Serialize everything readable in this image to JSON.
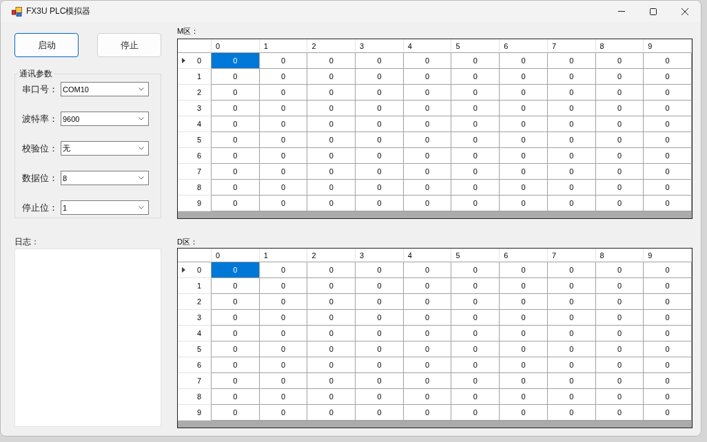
{
  "window": {
    "title": "FX3U PLC模拟器"
  },
  "buttons": [
    {
      "label": "启动",
      "focused": true
    },
    {
      "label": "停止",
      "focused": false
    }
  ],
  "comm_settings": {
    "title": "通讯参数",
    "fields": [
      {
        "label": "串口号：",
        "value": "COM10"
      },
      {
        "label": "波特率：",
        "value": "9600"
      },
      {
        "label": "校验位：",
        "value": "无"
      },
      {
        "label": "数据位：",
        "value": "8"
      },
      {
        "label": "停止位：",
        "value": "1"
      }
    ]
  },
  "log": {
    "label": "日志："
  },
  "grids": [
    {
      "label": "M区：",
      "columns": [
        "0",
        "1",
        "2",
        "3",
        "4",
        "5",
        "6",
        "7",
        "8",
        "9"
      ],
      "rows": [
        {
          "header": "0",
          "current": true,
          "cells": [
            {
              "value": "0",
              "selected": true
            },
            {
              "value": "0",
              "selected": false
            },
            {
              "value": "0",
              "selected": false
            },
            {
              "value": "0",
              "selected": false
            },
            {
              "value": "0",
              "selected": false
            },
            {
              "value": "0",
              "selected": false
            },
            {
              "value": "0",
              "selected": false
            },
            {
              "value": "0",
              "selected": false
            },
            {
              "value": "0",
              "selected": false
            },
            {
              "value": "0",
              "selected": false
            }
          ]
        },
        {
          "header": "1",
          "current": false,
          "cells": [
            {
              "value": "0",
              "selected": false
            },
            {
              "value": "0",
              "selected": false
            },
            {
              "value": "0",
              "selected": false
            },
            {
              "value": "0",
              "selected": false
            },
            {
              "value": "0",
              "selected": false
            },
            {
              "value": "0",
              "selected": false
            },
            {
              "value": "0",
              "selected": false
            },
            {
              "value": "0",
              "selected": false
            },
            {
              "value": "0",
              "selected": false
            },
            {
              "value": "0",
              "selected": false
            }
          ]
        },
        {
          "header": "2",
          "current": false,
          "cells": [
            {
              "value": "0",
              "selected": false
            },
            {
              "value": "0",
              "selected": false
            },
            {
              "value": "0",
              "selected": false
            },
            {
              "value": "0",
              "selected": false
            },
            {
              "value": "0",
              "selected": false
            },
            {
              "value": "0",
              "selected": false
            },
            {
              "value": "0",
              "selected": false
            },
            {
              "value": "0",
              "selected": false
            },
            {
              "value": "0",
              "selected": false
            },
            {
              "value": "0",
              "selected": false
            }
          ]
        },
        {
          "header": "3",
          "current": false,
          "cells": [
            {
              "value": "0",
              "selected": false
            },
            {
              "value": "0",
              "selected": false
            },
            {
              "value": "0",
              "selected": false
            },
            {
              "value": "0",
              "selected": false
            },
            {
              "value": "0",
              "selected": false
            },
            {
              "value": "0",
              "selected": false
            },
            {
              "value": "0",
              "selected": false
            },
            {
              "value": "0",
              "selected": false
            },
            {
              "value": "0",
              "selected": false
            },
            {
              "value": "0",
              "selected": false
            }
          ]
        },
        {
          "header": "4",
          "current": false,
          "cells": [
            {
              "value": "0",
              "selected": false
            },
            {
              "value": "0",
              "selected": false
            },
            {
              "value": "0",
              "selected": false
            },
            {
              "value": "0",
              "selected": false
            },
            {
              "value": "0",
              "selected": false
            },
            {
              "value": "0",
              "selected": false
            },
            {
              "value": "0",
              "selected": false
            },
            {
              "value": "0",
              "selected": false
            },
            {
              "value": "0",
              "selected": false
            },
            {
              "value": "0",
              "selected": false
            }
          ]
        },
        {
          "header": "5",
          "current": false,
          "cells": [
            {
              "value": "0",
              "selected": false
            },
            {
              "value": "0",
              "selected": false
            },
            {
              "value": "0",
              "selected": false
            },
            {
              "value": "0",
              "selected": false
            },
            {
              "value": "0",
              "selected": false
            },
            {
              "value": "0",
              "selected": false
            },
            {
              "value": "0",
              "selected": false
            },
            {
              "value": "0",
              "selected": false
            },
            {
              "value": "0",
              "selected": false
            },
            {
              "value": "0",
              "selected": false
            }
          ]
        },
        {
          "header": "6",
          "current": false,
          "cells": [
            {
              "value": "0",
              "selected": false
            },
            {
              "value": "0",
              "selected": false
            },
            {
              "value": "0",
              "selected": false
            },
            {
              "value": "0",
              "selected": false
            },
            {
              "value": "0",
              "selected": false
            },
            {
              "value": "0",
              "selected": false
            },
            {
              "value": "0",
              "selected": false
            },
            {
              "value": "0",
              "selected": false
            },
            {
              "value": "0",
              "selected": false
            },
            {
              "value": "0",
              "selected": false
            }
          ]
        },
        {
          "header": "7",
          "current": false,
          "cells": [
            {
              "value": "0",
              "selected": false
            },
            {
              "value": "0",
              "selected": false
            },
            {
              "value": "0",
              "selected": false
            },
            {
              "value": "0",
              "selected": false
            },
            {
              "value": "0",
              "selected": false
            },
            {
              "value": "0",
              "selected": false
            },
            {
              "value": "0",
              "selected": false
            },
            {
              "value": "0",
              "selected": false
            },
            {
              "value": "0",
              "selected": false
            },
            {
              "value": "0",
              "selected": false
            }
          ]
        },
        {
          "header": "8",
          "current": false,
          "cells": [
            {
              "value": "0",
              "selected": false
            },
            {
              "value": "0",
              "selected": false
            },
            {
              "value": "0",
              "selected": false
            },
            {
              "value": "0",
              "selected": false
            },
            {
              "value": "0",
              "selected": false
            },
            {
              "value": "0",
              "selected": false
            },
            {
              "value": "0",
              "selected": false
            },
            {
              "value": "0",
              "selected": false
            },
            {
              "value": "0",
              "selected": false
            },
            {
              "value": "0",
              "selected": false
            }
          ]
        },
        {
          "header": "9",
          "current": false,
          "cells": [
            {
              "value": "0",
              "selected": false
            },
            {
              "value": "0",
              "selected": false
            },
            {
              "value": "0",
              "selected": false
            },
            {
              "value": "0",
              "selected": false
            },
            {
              "value": "0",
              "selected": false
            },
            {
              "value": "0",
              "selected": false
            },
            {
              "value": "0",
              "selected": false
            },
            {
              "value": "0",
              "selected": false
            },
            {
              "value": "0",
              "selected": false
            },
            {
              "value": "0",
              "selected": false
            }
          ]
        }
      ]
    },
    {
      "label": "D区：",
      "columns": [
        "0",
        "1",
        "2",
        "3",
        "4",
        "5",
        "6",
        "7",
        "8",
        "9"
      ],
      "rows": [
        {
          "header": "0",
          "current": true,
          "cells": [
            {
              "value": "0",
              "selected": true
            },
            {
              "value": "0",
              "selected": false
            },
            {
              "value": "0",
              "selected": false
            },
            {
              "value": "0",
              "selected": false
            },
            {
              "value": "0",
              "selected": false
            },
            {
              "value": "0",
              "selected": false
            },
            {
              "value": "0",
              "selected": false
            },
            {
              "value": "0",
              "selected": false
            },
            {
              "value": "0",
              "selected": false
            },
            {
              "value": "0",
              "selected": false
            }
          ]
        },
        {
          "header": "1",
          "current": false,
          "cells": [
            {
              "value": "0",
              "selected": false
            },
            {
              "value": "0",
              "selected": false
            },
            {
              "value": "0",
              "selected": false
            },
            {
              "value": "0",
              "selected": false
            },
            {
              "value": "0",
              "selected": false
            },
            {
              "value": "0",
              "selected": false
            },
            {
              "value": "0",
              "selected": false
            },
            {
              "value": "0",
              "selected": false
            },
            {
              "value": "0",
              "selected": false
            },
            {
              "value": "0",
              "selected": false
            }
          ]
        },
        {
          "header": "2",
          "current": false,
          "cells": [
            {
              "value": "0",
              "selected": false
            },
            {
              "value": "0",
              "selected": false
            },
            {
              "value": "0",
              "selected": false
            },
            {
              "value": "0",
              "selected": false
            },
            {
              "value": "0",
              "selected": false
            },
            {
              "value": "0",
              "selected": false
            },
            {
              "value": "0",
              "selected": false
            },
            {
              "value": "0",
              "selected": false
            },
            {
              "value": "0",
              "selected": false
            },
            {
              "value": "0",
              "selected": false
            }
          ]
        },
        {
          "header": "3",
          "current": false,
          "cells": [
            {
              "value": "0",
              "selected": false
            },
            {
              "value": "0",
              "selected": false
            },
            {
              "value": "0",
              "selected": false
            },
            {
              "value": "0",
              "selected": false
            },
            {
              "value": "0",
              "selected": false
            },
            {
              "value": "0",
              "selected": false
            },
            {
              "value": "0",
              "selected": false
            },
            {
              "value": "0",
              "selected": false
            },
            {
              "value": "0",
              "selected": false
            },
            {
              "value": "0",
              "selected": false
            }
          ]
        },
        {
          "header": "4",
          "current": false,
          "cells": [
            {
              "value": "0",
              "selected": false
            },
            {
              "value": "0",
              "selected": false
            },
            {
              "value": "0",
              "selected": false
            },
            {
              "value": "0",
              "selected": false
            },
            {
              "value": "0",
              "selected": false
            },
            {
              "value": "0",
              "selected": false
            },
            {
              "value": "0",
              "selected": false
            },
            {
              "value": "0",
              "selected": false
            },
            {
              "value": "0",
              "selected": false
            },
            {
              "value": "0",
              "selected": false
            }
          ]
        },
        {
          "header": "5",
          "current": false,
          "cells": [
            {
              "value": "0",
              "selected": false
            },
            {
              "value": "0",
              "selected": false
            },
            {
              "value": "0",
              "selected": false
            },
            {
              "value": "0",
              "selected": false
            },
            {
              "value": "0",
              "selected": false
            },
            {
              "value": "0",
              "selected": false
            },
            {
              "value": "0",
              "selected": false
            },
            {
              "value": "0",
              "selected": false
            },
            {
              "value": "0",
              "selected": false
            },
            {
              "value": "0",
              "selected": false
            }
          ]
        },
        {
          "header": "6",
          "current": false,
          "cells": [
            {
              "value": "0",
              "selected": false
            },
            {
              "value": "0",
              "selected": false
            },
            {
              "value": "0",
              "selected": false
            },
            {
              "value": "0",
              "selected": false
            },
            {
              "value": "0",
              "selected": false
            },
            {
              "value": "0",
              "selected": false
            },
            {
              "value": "0",
              "selected": false
            },
            {
              "value": "0",
              "selected": false
            },
            {
              "value": "0",
              "selected": false
            },
            {
              "value": "0",
              "selected": false
            }
          ]
        },
        {
          "header": "7",
          "current": false,
          "cells": [
            {
              "value": "0",
              "selected": false
            },
            {
              "value": "0",
              "selected": false
            },
            {
              "value": "0",
              "selected": false
            },
            {
              "value": "0",
              "selected": false
            },
            {
              "value": "0",
              "selected": false
            },
            {
              "value": "0",
              "selected": false
            },
            {
              "value": "0",
              "selected": false
            },
            {
              "value": "0",
              "selected": false
            },
            {
              "value": "0",
              "selected": false
            },
            {
              "value": "0",
              "selected": false
            }
          ]
        },
        {
          "header": "8",
          "current": false,
          "cells": [
            {
              "value": "0",
              "selected": false
            },
            {
              "value": "0",
              "selected": false
            },
            {
              "value": "0",
              "selected": false
            },
            {
              "value": "0",
              "selected": false
            },
            {
              "value": "0",
              "selected": false
            },
            {
              "value": "0",
              "selected": false
            },
            {
              "value": "0",
              "selected": false
            },
            {
              "value": "0",
              "selected": false
            },
            {
              "value": "0",
              "selected": false
            },
            {
              "value": "0",
              "selected": false
            }
          ]
        },
        {
          "header": "9",
          "current": false,
          "cells": [
            {
              "value": "0",
              "selected": false
            },
            {
              "value": "0",
              "selected": false
            },
            {
              "value": "0",
              "selected": false
            },
            {
              "value": "0",
              "selected": false
            },
            {
              "value": "0",
              "selected": false
            },
            {
              "value": "0",
              "selected": false
            },
            {
              "value": "0",
              "selected": false
            },
            {
              "value": "0",
              "selected": false
            },
            {
              "value": "0",
              "selected": false
            },
            {
              "value": "0",
              "selected": false
            }
          ]
        }
      ]
    }
  ]
}
